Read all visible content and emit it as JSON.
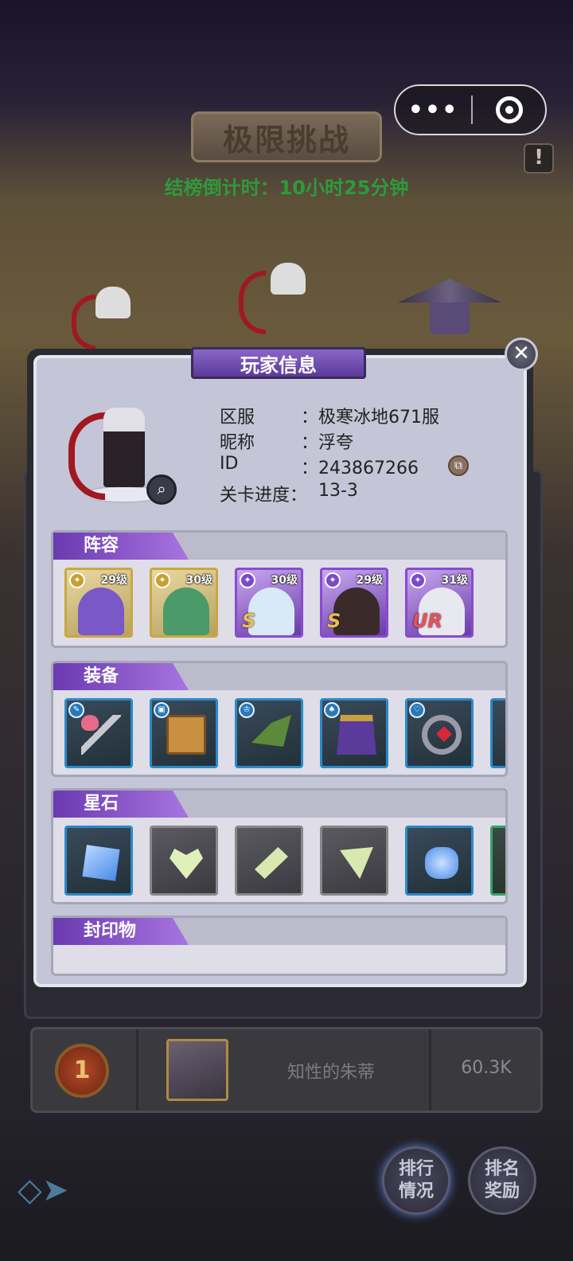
{
  "topbar": {
    "menu_dots": "•••"
  },
  "page": {
    "title": "极限挑战",
    "countdown": "结榜倒计时：10小时25分钟",
    "help_label": "!"
  },
  "modal": {
    "title": "玩家信息",
    "close_label": "✕",
    "info": [
      {
        "label": "区服",
        "value": "：极寒冰地671服"
      },
      {
        "label": "昵称",
        "value": "：浮夸"
      },
      {
        "label": "ID",
        "value": "：243867266"
      },
      {
        "label": "关卡进度：",
        "value": "13-3"
      }
    ],
    "copy_icon": "copy-icon",
    "sections": {
      "lineup": {
        "title": "阵容",
        "heroes": [
          {
            "level": "29级",
            "frame": "gold",
            "rarity": ""
          },
          {
            "level": "30级",
            "frame": "gold",
            "rarity": ""
          },
          {
            "level": "30级",
            "frame": "purple",
            "rarity": "S"
          },
          {
            "level": "29级",
            "frame": "purple",
            "rarity": "S"
          },
          {
            "level": "31级",
            "frame": "purple",
            "rarity": "UR"
          }
        ]
      },
      "equipment": {
        "title": "装备",
        "items": [
          "wand-icon",
          "book-icon",
          "hat-icon",
          "cape-icon",
          "bracelet-icon"
        ]
      },
      "starstone": {
        "title": "星石",
        "items": [
          "blue-square-gem",
          "green-heart-gem",
          "green-diamond-gem",
          "green-triangle-gem",
          "blue-round-gem"
        ]
      },
      "seal": {
        "title": "封印物"
      }
    }
  },
  "ranking": {
    "rank": "1",
    "name": "知性的朱蒂",
    "score": "60.3K"
  },
  "nav": {
    "rank_status": "排行\n情况",
    "rank_reward": "排名\n奖励"
  },
  "colors": {
    "accent_purple": "#8a4ad0",
    "countdown_green": "#2e9a3c"
  }
}
